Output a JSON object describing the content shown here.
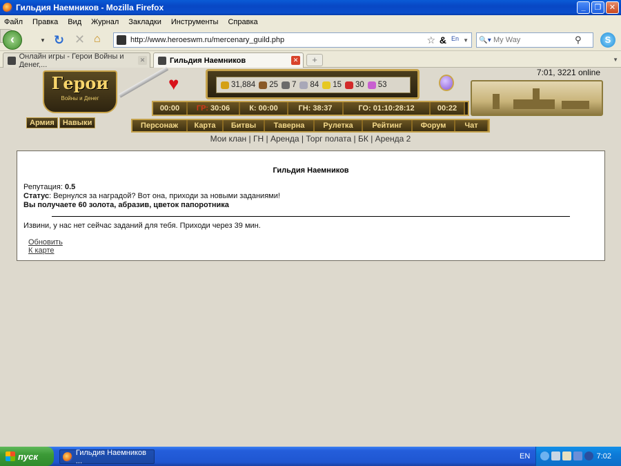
{
  "window": {
    "title": "Гильдия Наемников - Mozilla Firefox"
  },
  "menu": [
    "Файл",
    "Правка",
    "Вид",
    "Журнал",
    "Закладки",
    "Инструменты",
    "Справка"
  ],
  "toolbar": {
    "url": "http://www.heroeswm.ru/mercenary_guild.php",
    "search_placeholder": "My Way"
  },
  "tabs": [
    {
      "label": "Онлайн игры - Герои Войны и Денег,..."
    },
    {
      "label": "Гильдия Наемников"
    }
  ],
  "game": {
    "logo_title": "Герои",
    "logo_subtitle": "Войны и Денег",
    "online": "7:01, 3221 online",
    "resources": [
      {
        "icon": "gold-icon",
        "value": "31,884",
        "color": "#d4a014"
      },
      {
        "icon": "wood-icon",
        "value": "25",
        "color": "#8a5a28"
      },
      {
        "icon": "ore-icon",
        "value": "7",
        "color": "#6a6a6a"
      },
      {
        "icon": "mercury-icon",
        "value": "84",
        "color": "#a8a8b8"
      },
      {
        "icon": "sulfur-icon",
        "value": "15",
        "color": "#e6c820"
      },
      {
        "icon": "crystal-icon",
        "value": "30",
        "color": "#d22a2a"
      },
      {
        "icon": "gems-icon",
        "value": "53",
        "color": "#c860d0"
      }
    ],
    "timers": [
      {
        "label": "",
        "value": "00:00"
      },
      {
        "label": "ГР:",
        "value": " 30:06"
      },
      {
        "label": "",
        "value": "К: 00:00"
      },
      {
        "label": "",
        "value": "ГН: 38:37"
      },
      {
        "label": "",
        "value": "ГО: 01:10:28:12"
      },
      {
        "label": "",
        "value": "00:22"
      }
    ],
    "side_nav": [
      "Армия",
      "Навыки"
    ],
    "main_nav": [
      "Персонаж",
      "Карта",
      "Битвы",
      "Таверна",
      "Рулетка",
      "Рейтинг",
      "Форум",
      "Чат"
    ],
    "sub_links": [
      "Мои клан",
      "ГН",
      "Аренда",
      "Торг полата",
      "БК",
      "Аренда 2"
    ],
    "sub_sep": " | "
  },
  "content": {
    "title": "Гильдия Наемников",
    "rep_label": "Репутация:",
    "rep_value": "0.5",
    "status_label": "Статус",
    "status_text": ": Вернулся за наградой? Вот она, приходи за новыми заданиями!",
    "reward": "Вы получаете 60 золота, абразив, цветок папоротника",
    "no_tasks": "Извини, у нас нет сейчас заданий для тебя. Приходи через 39 мин.",
    "refresh_link": "Обновить",
    "map_link": "К карте"
  },
  "taskbar": {
    "start": "пуск",
    "task": "Гильдия Наемников ...",
    "lang": "EN",
    "clock": "7:02"
  }
}
